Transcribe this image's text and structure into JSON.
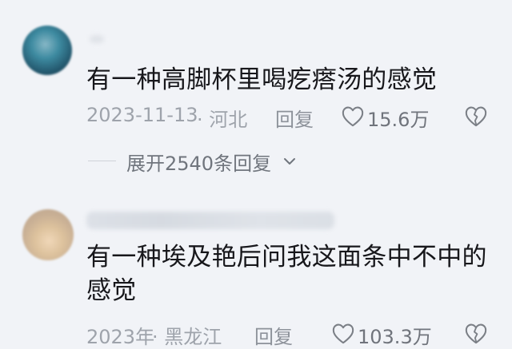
{
  "comments": [
    {
      "avatar_icon": "user-avatar-icon",
      "text_lines": [
        "有一种高脚杯里喝疙瘩汤的感觉"
      ],
      "date": "2023-11-13",
      "location": "河北",
      "reply_label": "回复",
      "like_count": "15.6万",
      "expand_replies": "展开2540条回复"
    },
    {
      "avatar_icon": "user-avatar-icon",
      "text_lines": [
        "有一种埃及艳后问我这面条中不中的",
        "感觉"
      ],
      "date": "2023年",
      "location": "黑龙江",
      "reply_label": "回复",
      "like_count": "103.3万"
    }
  ],
  "colors": {
    "background": "#f1f3f7",
    "text": "#17171b",
    "meta": "#9ea3ab",
    "icon": "#70747c"
  }
}
